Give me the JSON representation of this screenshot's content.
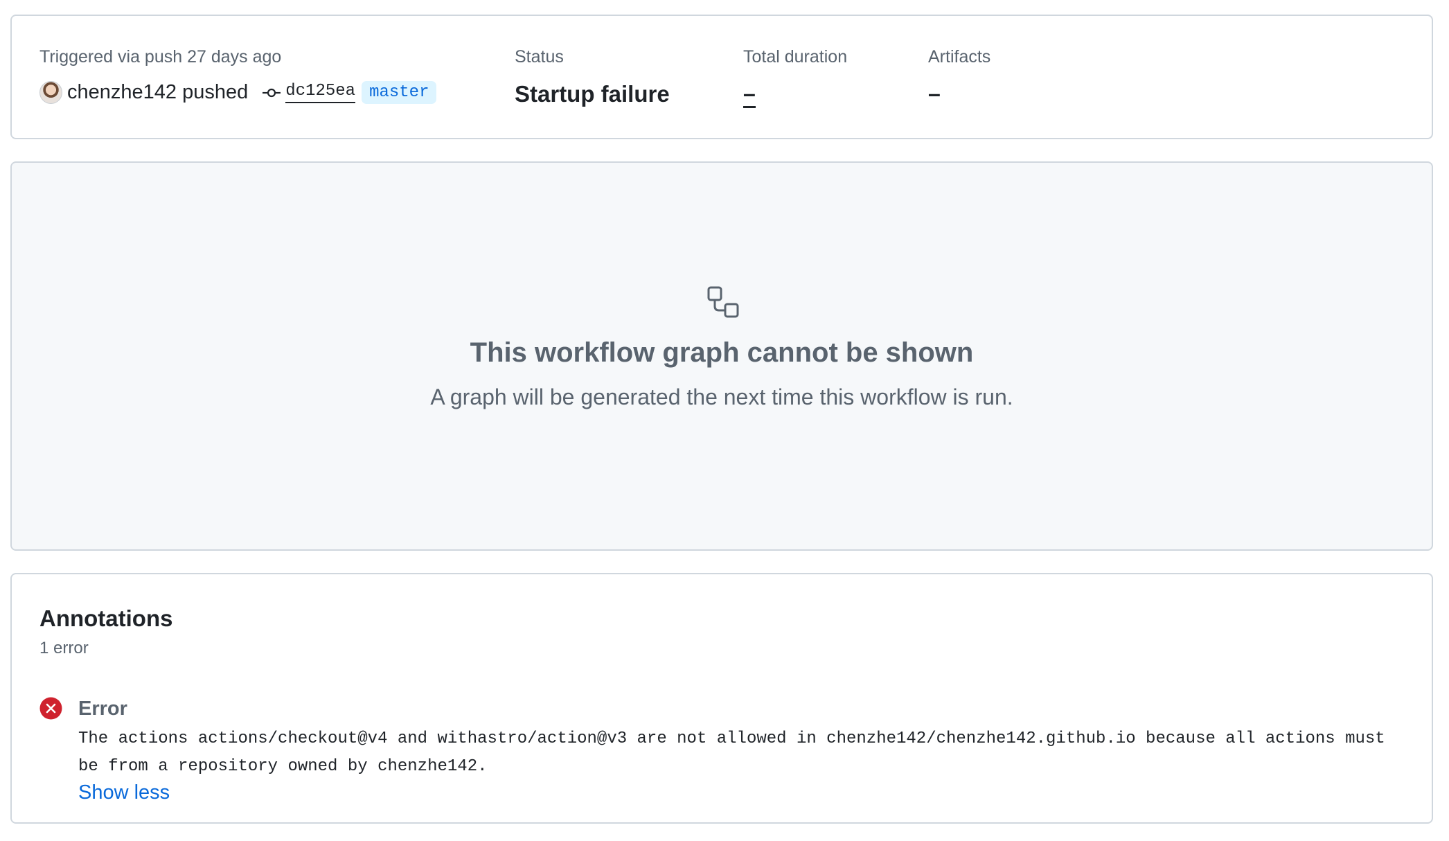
{
  "summary": {
    "trigger_label": "Triggered via push 27 days ago",
    "actor": "chenzhe142 pushed",
    "commit_sha": "dc125ea",
    "branch": "master",
    "status_label": "Status",
    "status_value": "Startup failure",
    "duration_label": "Total duration",
    "duration_value": "–",
    "artifacts_label": "Artifacts",
    "artifacts_value": "–"
  },
  "graph": {
    "icon": "workflow-icon",
    "title": "This workflow graph cannot be shown",
    "subtitle": "A graph will be generated the next time this workflow is run."
  },
  "annotations": {
    "title": "Annotations",
    "count": "1 error",
    "items": [
      {
        "icon": "x-circle-fill-icon",
        "title": "Error",
        "message": "The actions actions/checkout@v4 and withastro/action@v3 are not allowed in chenzhe142/chenzhe142.github.io because all actions must be from a repository owned by chenzhe142.",
        "toggle": "Show less"
      }
    ]
  },
  "colors": {
    "border": "#d0d7de",
    "muted": "#59636e",
    "link": "#0969da",
    "branch_bg": "#ddf4ff",
    "error": "#cf222e",
    "graph_bg": "#f6f8fa"
  }
}
